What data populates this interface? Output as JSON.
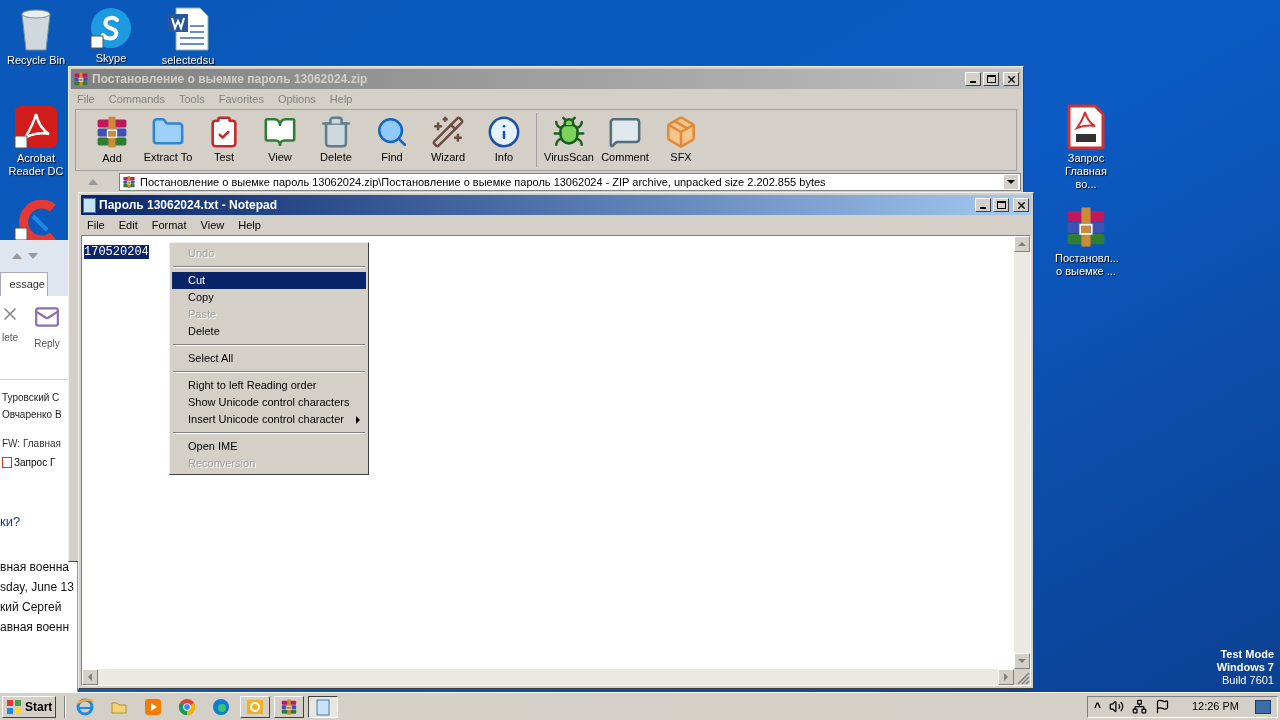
{
  "desktop": {
    "icons": [
      {
        "label": "Recycle Bin",
        "kind": "recycle"
      },
      {
        "label": "Skype",
        "kind": "skype"
      },
      {
        "label": "selectedsu",
        "kind": "word"
      },
      {
        "label": "Acrobat Reader DC",
        "kind": "acrobat"
      },
      {
        "kind": "ccleaner"
      },
      {
        "label": "Запрос Главная во...",
        "kind": "pdf"
      },
      {
        "label": "Постановл... о выемке  ...",
        "kind": "rar"
      }
    ],
    "os_notice": [
      "Test Mode",
      "Windows 7",
      "Build 7601"
    ]
  },
  "outlook": {
    "tab": "essage",
    "ribbon": [
      {
        "label": "lete",
        "kind": "delete"
      },
      {
        "label": "Reply",
        "kind": "reply"
      }
    ],
    "recipients": [
      "Туровский С",
      "Овчаренко В"
    ],
    "subject": "FW: Главная",
    "attachment": "Запрос Г",
    "question": "ки?",
    "body": [
      "вная военна",
      "sday, June 13",
      "кий Сергей",
      "авная военн"
    ]
  },
  "winrar": {
    "title": "Постановление о выемке  пароль 13062024.zip",
    "active": false,
    "menu": [
      "File",
      "Commands",
      "Tools",
      "Favorites",
      "Options",
      "Help"
    ],
    "toolbar": [
      {
        "label": "Add",
        "kind": "add"
      },
      {
        "label": "Extract To",
        "kind": "extract"
      },
      {
        "label": "Test",
        "kind": "test"
      },
      {
        "label": "View",
        "kind": "view"
      },
      {
        "label": "Delete",
        "kind": "delete"
      },
      {
        "label": "Find",
        "kind": "find"
      },
      {
        "label": "Wizard",
        "kind": "wizard"
      },
      {
        "label": "Info",
        "kind": "info"
      },
      {
        "kind": "separator"
      },
      {
        "label": "VirusScan",
        "kind": "virus"
      },
      {
        "label": "Comment",
        "kind": "comment"
      },
      {
        "label": "SFX",
        "kind": "sfx"
      }
    ],
    "path": "Постановление о выемке  пароль 13062024.zip\\Постановление о выемке  пароль 13062024 - ZIP archive, unpacked size 2.202.855 bytes"
  },
  "notepad": {
    "title": "Пароль 13062024.txt - Notepad",
    "active": true,
    "menu": [
      "File",
      "Edit",
      "Format",
      "View",
      "Help"
    ],
    "text": "170520204",
    "text_selected": true
  },
  "context_menu": [
    {
      "kind": "item",
      "label": "Undo",
      "disabled": true,
      "selected": false,
      "submenu": false
    },
    {
      "kind": "separator"
    },
    {
      "kind": "item",
      "label": "Cut",
      "disabled": false,
      "selected": true,
      "submenu": false
    },
    {
      "kind": "item",
      "label": "Copy",
      "disabled": false,
      "selected": false,
      "submenu": false
    },
    {
      "kind": "item",
      "label": "Paste",
      "disabled": true,
      "selected": false,
      "submenu": false
    },
    {
      "kind": "item",
      "label": "Delete",
      "disabled": false,
      "selected": false,
      "submenu": false
    },
    {
      "kind": "separator"
    },
    {
      "kind": "item",
      "label": "Select All",
      "disabled": false,
      "selected": false,
      "submenu": false
    },
    {
      "kind": "separator"
    },
    {
      "kind": "item",
      "label": "Right to left Reading order",
      "disabled": false,
      "selected": false,
      "submenu": false
    },
    {
      "kind": "item",
      "label": "Show Unicode control characters",
      "disabled": false,
      "selected": false,
      "submenu": false
    },
    {
      "kind": "item",
      "label": "Insert Unicode control character",
      "disabled": false,
      "selected": false,
      "submenu": true
    },
    {
      "kind": "separator"
    },
    {
      "kind": "item",
      "label": "Open IME",
      "disabled": false,
      "selected": false,
      "submenu": false
    },
    {
      "kind": "item",
      "label": "Reconversion",
      "disabled": true,
      "selected": false,
      "submenu": false
    }
  ],
  "taskbar": {
    "start": "Start",
    "apps": [
      {
        "kind": "ie",
        "running": false,
        "selected": false
      },
      {
        "kind": "explorer",
        "running": false,
        "selected": false
      },
      {
        "kind": "media",
        "running": false,
        "selected": false
      },
      {
        "kind": "chrome",
        "running": false,
        "selected": false
      },
      {
        "kind": "edge",
        "running": false,
        "selected": false
      },
      {
        "kind": "outlook",
        "running": true,
        "selected": false
      },
      {
        "kind": "winrar",
        "running": true,
        "selected": false
      },
      {
        "kind": "notepad",
        "running": true,
        "selected": true
      }
    ],
    "tray_chevron": "^",
    "clock": "12:26 PM"
  }
}
